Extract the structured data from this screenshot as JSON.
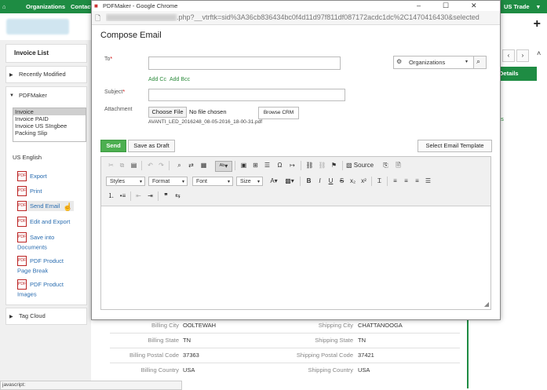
{
  "app": {
    "topbar": {
      "organizations": "Organizations",
      "contacts": "Contact",
      "trade": "US Trade"
    },
    "left_panel": {
      "invoice_list": "Invoice List",
      "recently_modified": "Recently Modified",
      "pdfmaker": "PDFMaker",
      "templates": [
        "Invoice",
        "Invoice PAID",
        "Invoice US SIngbee",
        "Packing Slip"
      ],
      "language": "US English",
      "actions": [
        "Export",
        "Print",
        "Send Email",
        "Edit and Export",
        "Save into Documents",
        "PDF Product Page Break",
        "PDF Product Images"
      ],
      "tag_cloud": "Tag Cloud"
    },
    "right_panel": {
      "details": "Details",
      "links_text": "ts"
    },
    "address_table": [
      {
        "label_l": "Billing City",
        "value_l": "OOLTEWAH",
        "label_r": "Shipping City",
        "value_r": "CHATTANOOGA"
      },
      {
        "label_l": "Billing State",
        "value_l": "TN",
        "label_r": "Shipping State",
        "value_r": "TN"
      },
      {
        "label_l": "Billing Postal Code",
        "value_l": "37363",
        "label_r": "Shipping Postal Code",
        "value_r": "37421"
      },
      {
        "label_l": "Billing Country",
        "value_l": "USA",
        "label_r": "Shipping Country",
        "value_r": "USA"
      }
    ],
    "status_text": "javascript:"
  },
  "popup": {
    "window_title": "PDFMaker - Google Chrome",
    "url_visible": ".php?__vtrftk=sid%3A36cb836434bc0f4d11d97f811df087172acdc1dc%2C1470416430&selected",
    "compose_title": "Compose Email",
    "to_label": "To",
    "subject_label": "Subject",
    "attachment_label": "Attachment",
    "add_cc": "Add Cc",
    "add_bcc": "Add Bcc",
    "module_select": "Organizations",
    "choose_file": "Choose File",
    "no_file": "No file chosen",
    "browse_crm": "Browse CRM",
    "attachment_file": "AVANTI_LED_2016248_08-05-2016_18-00-31.pdf",
    "send": "Send",
    "save_draft": "Save as Draft",
    "select_template": "Select Email Template",
    "toolbar": {
      "source": "Source",
      "styles": "Styles",
      "format": "Format",
      "font": "Font",
      "size": "Size"
    }
  }
}
